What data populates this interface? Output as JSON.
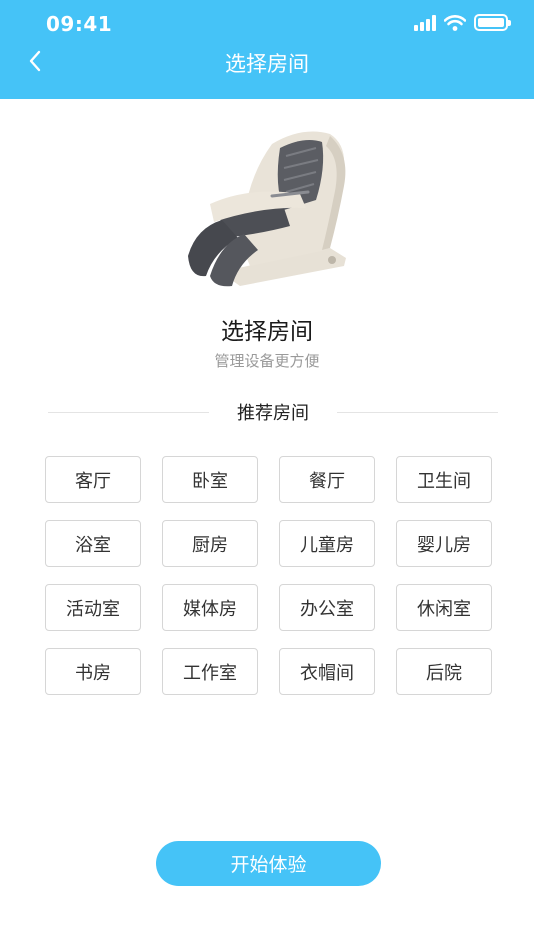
{
  "status_bar": {
    "time": "09:41"
  },
  "header": {
    "title": "选择房间"
  },
  "hero": {
    "title": "选择房间",
    "subtitle": "管理设备更方便"
  },
  "section": {
    "label": "推荐房间"
  },
  "rooms": [
    "客厅",
    "卧室",
    "餐厅",
    "卫生间",
    "浴室",
    "厨房",
    "儿童房",
    "婴儿房",
    "活动室",
    "媒体房",
    "办公室",
    "休闲室",
    "书房",
    "工作室",
    "衣帽间",
    "后院"
  ],
  "footer": {
    "start_label": "开始体验"
  },
  "colors": {
    "accent": "#45c3f7",
    "border": "#d6d6d6",
    "muted": "#9a9a9a"
  },
  "icons": {
    "back": "chevron-left-icon",
    "signal": "cellular-signal-icon",
    "wifi": "wifi-icon",
    "battery": "battery-icon"
  }
}
